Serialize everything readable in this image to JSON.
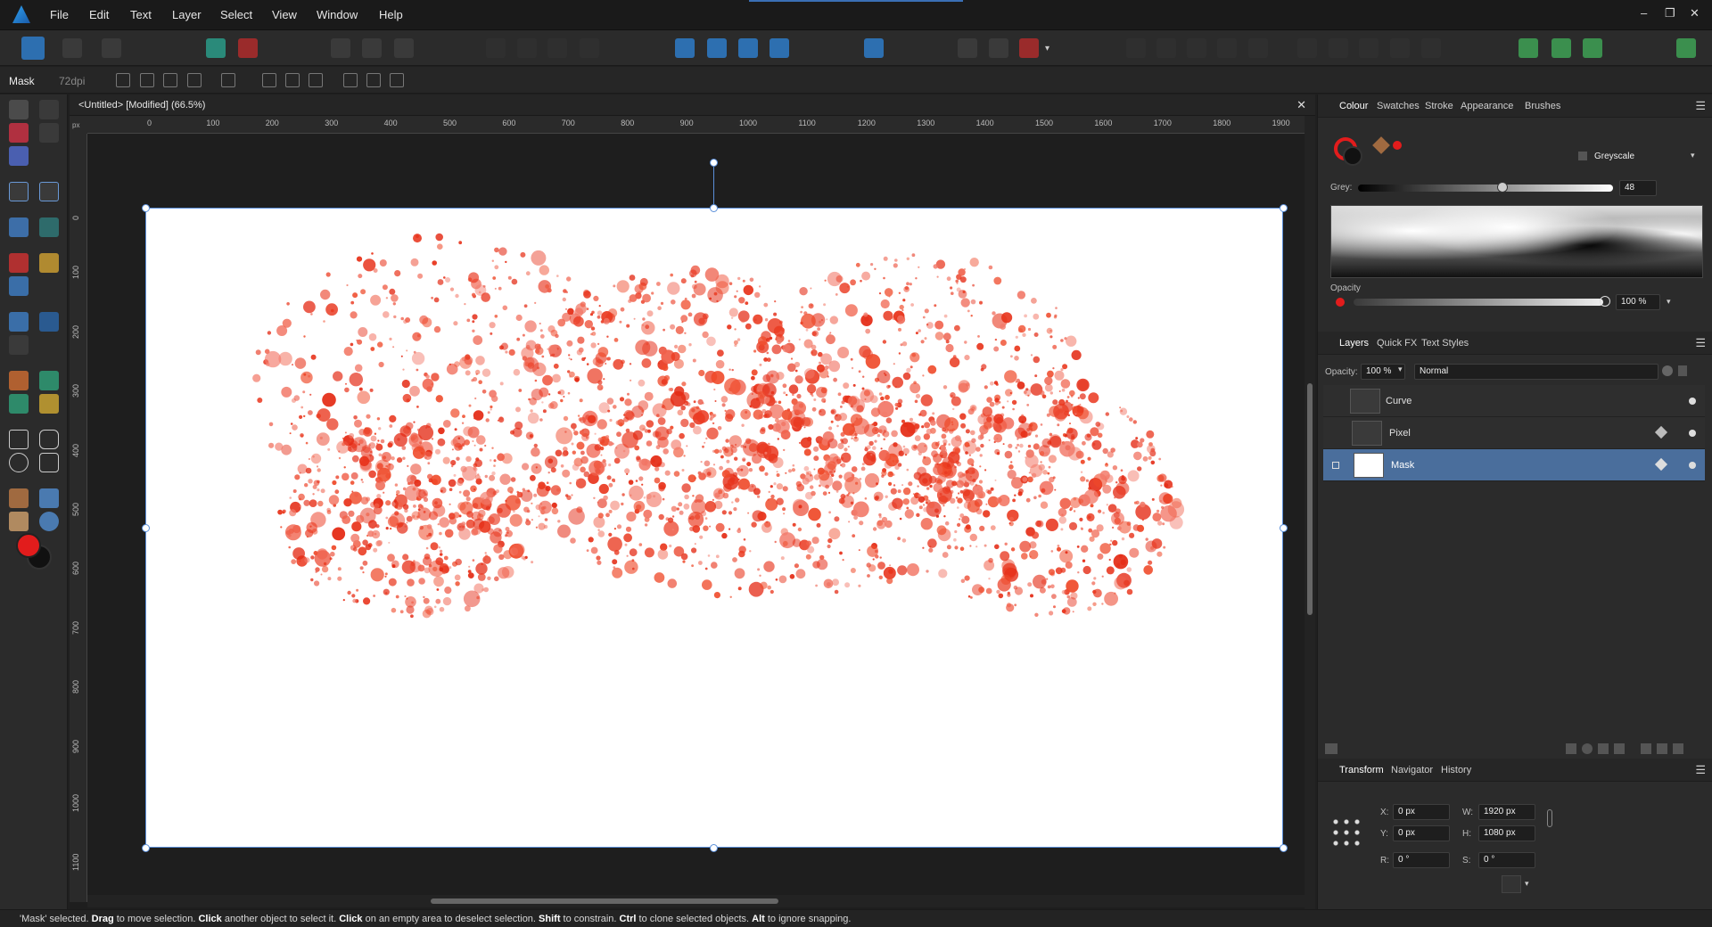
{
  "menubar": {
    "items": [
      "File",
      "Edit",
      "Text",
      "Layer",
      "Select",
      "View",
      "Window",
      "Help"
    ],
    "window_controls": [
      "–",
      "❐",
      "✕"
    ]
  },
  "context": {
    "selection_label": "Mask",
    "dpi": "72dpi"
  },
  "document": {
    "tab_title": "<Untitled> [Modified] (66.5%)",
    "close": "✕"
  },
  "rulers": {
    "unit": "px",
    "horizontal_ticks": [
      "0",
      "100",
      "200",
      "300",
      "400",
      "500",
      "600",
      "700",
      "800",
      "900",
      "1000",
      "1100",
      "1200",
      "1300",
      "1400",
      "1500",
      "1600",
      "1700",
      "1800",
      "1900"
    ],
    "vertical_ticks": [
      "0",
      "100",
      "200",
      "300",
      "400",
      "500",
      "600",
      "700",
      "800",
      "900",
      "1000",
      "1100"
    ]
  },
  "colour_panel": {
    "tabs": [
      "Colour",
      "Swatches",
      "Stroke",
      "Appearance",
      "Brushes"
    ],
    "active_tab": "Colour",
    "mode": "Greyscale",
    "grey_label": "Grey:",
    "grey_value": "48",
    "grey_level": 0.48,
    "opacity_label": "Opacity",
    "opacity_value": "100 %",
    "fill_color": "#e21c1c",
    "stroke_color": "#111111"
  },
  "layers_panel": {
    "tabs": [
      "Layers",
      "Quick FX",
      "Text Styles"
    ],
    "active_tab": "Layers",
    "opacity_label": "Opacity:",
    "opacity_value": "100 %",
    "blend_mode": "Normal",
    "layers": [
      {
        "name": "Curve",
        "selected": false
      },
      {
        "name": "Pixel",
        "selected": false
      },
      {
        "name": "Mask",
        "selected": true
      }
    ]
  },
  "transform_panel": {
    "tabs": [
      "Transform",
      "Navigator",
      "History"
    ],
    "active_tab": "Transform",
    "x_label": "X:",
    "x_value": "0 px",
    "y_label": "Y:",
    "y_value": "0 px",
    "w_label": "W:",
    "w_value": "1920 px",
    "h_label": "H:",
    "h_value": "1080 px",
    "r_label": "R:",
    "r_value": "0 °",
    "s_label": "S:",
    "s_value": "0 °"
  },
  "status": {
    "parts": [
      {
        "t": "'Mask' selected. ",
        "b": false
      },
      {
        "t": "Drag",
        "b": true
      },
      {
        "t": " to move selection. ",
        "b": false
      },
      {
        "t": "Click",
        "b": true
      },
      {
        "t": " another object to select it. ",
        "b": false
      },
      {
        "t": "Click",
        "b": true
      },
      {
        "t": " on an empty area to deselect selection. ",
        "b": false
      },
      {
        "t": "Shift",
        "b": true
      },
      {
        "t": " to constrain. ",
        "b": false
      },
      {
        "t": "Ctrl",
        "b": true
      },
      {
        "t": " to clone selected objects. ",
        "b": false
      },
      {
        "t": "Alt",
        "b": true
      },
      {
        "t": " to ignore snapping.",
        "b": false
      }
    ]
  },
  "colors": {
    "accent": "#5b8fd9",
    "paint_red": "#e8341c",
    "selected_layer": "#4a6e9c"
  }
}
